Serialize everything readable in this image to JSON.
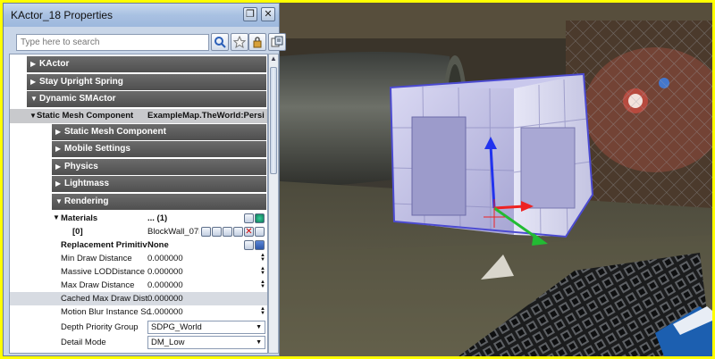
{
  "window": {
    "title": "KActor_18 Properties",
    "restore_glyph": "❐",
    "close_glyph": "✕"
  },
  "search": {
    "placeholder": "Type here to search"
  },
  "toolbar": {
    "icons": [
      "find-icon",
      "favorite-star-icon",
      "lock-icon",
      "copy-properties-icon"
    ]
  },
  "categories": {
    "kactor": "KActor",
    "upright_spring": "Stay Upright Spring",
    "dynamic": "Dynamic SMActor",
    "static_mesh_component": "Static Mesh Component",
    "mobile": "Mobile Settings",
    "physics": "Physics",
    "lightmass": "Lightmass",
    "rendering": "Rendering"
  },
  "component_row": {
    "label": "Static Mesh Component",
    "value": "ExampleMap.TheWorld:Persi"
  },
  "materials": {
    "label": "Materials",
    "value": "... (1)",
    "index_label": "[0]",
    "index_value": "BlockWall_07b"
  },
  "properties": [
    {
      "label": "Replacement Primitiv",
      "value": "None",
      "bold": true
    },
    {
      "label": "Min Draw Distance",
      "value": "0.000000"
    },
    {
      "label": "Massive LODDistance",
      "value": "0.000000"
    },
    {
      "label": "Max Draw Distance",
      "value": "0.000000"
    },
    {
      "label": "Cached Max Draw Distar",
      "value": "0.000000"
    },
    {
      "label": "Motion Blur Instance Sca",
      "value": "1.000000"
    }
  ],
  "depth_priority": {
    "label": "Depth Priority Group",
    "value": "SDPG_World"
  },
  "detail_mode": {
    "label": "Detail Mode",
    "value": "DM_Low"
  },
  "colors": {
    "accent_yellow": "#ffff00",
    "category_bg": "#5a5a5a",
    "window_bg": "#c9d6e8",
    "mesh_tint": "#b9b8e0"
  }
}
